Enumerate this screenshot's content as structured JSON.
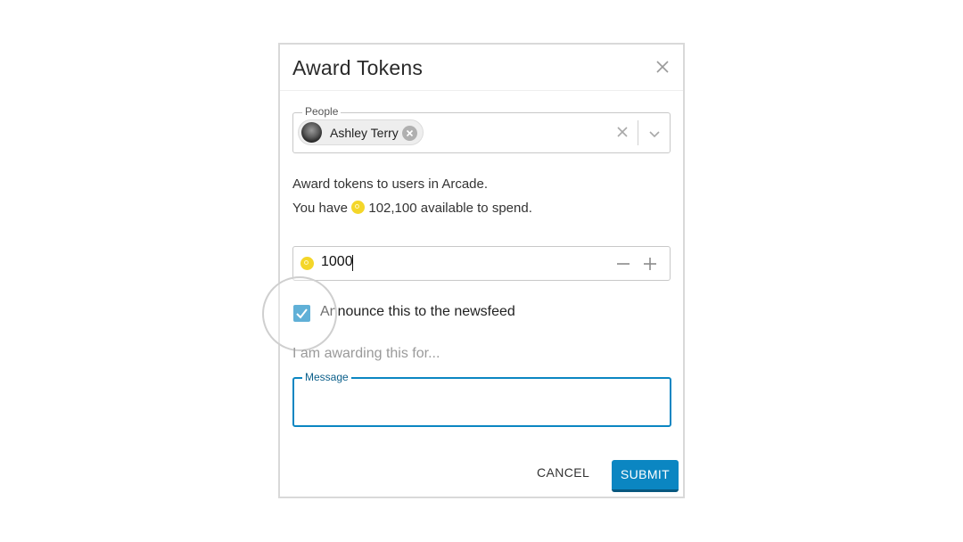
{
  "dialog": {
    "title": "Award Tokens"
  },
  "people": {
    "legend": "People",
    "selected": [
      {
        "name": "Ashley Terry"
      }
    ]
  },
  "description": {
    "line1": "Award tokens to users in Arcade.",
    "line2_prefix": "You have",
    "available": "102,100",
    "line2_suffix": "available to spend."
  },
  "amount": {
    "value": "1000"
  },
  "announce": {
    "checked": true,
    "label": "Announce this to the newsfeed"
  },
  "reason": {
    "prompt": "I am awarding this for...",
    "message_legend": "Message",
    "message_value": ""
  },
  "actions": {
    "cancel_label": "CANCEL",
    "submit_label": "SUBMIT"
  },
  "colors": {
    "accent": "#0b86c2",
    "coin": "#f4d629"
  },
  "icons": {
    "close": "close-icon",
    "chip_remove": "remove-chip-icon",
    "clear": "clear-icon",
    "dropdown": "chevron-down-icon",
    "coin": "token-coin-icon",
    "minus": "minus-icon",
    "plus": "plus-icon",
    "check": "checkmark-icon"
  }
}
